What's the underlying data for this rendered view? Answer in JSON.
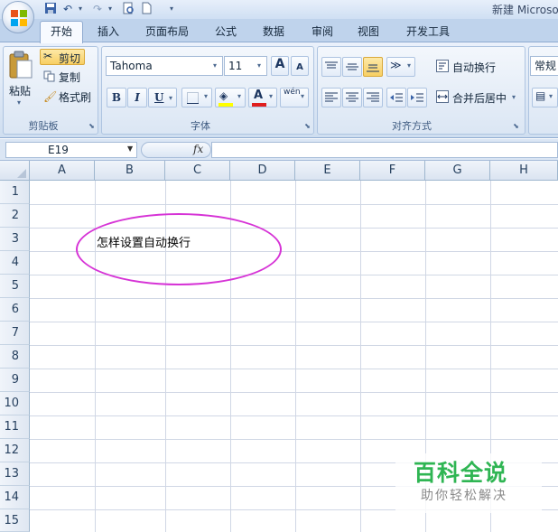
{
  "window": {
    "title": "新建 Microso"
  },
  "tabs": [
    "开始",
    "插入",
    "页面布局",
    "公式",
    "数据",
    "审阅",
    "视图",
    "开发工具"
  ],
  "clipboard": {
    "paste_label": "粘贴",
    "cut_label": "剪切",
    "copy_label": "复制",
    "format_painter_label": "格式刷",
    "group_label": "剪贴板"
  },
  "font": {
    "name": "Tahoma",
    "size": "11",
    "group_label": "字体",
    "grow_label": "A",
    "shrink_label": "A",
    "bold_label": "B",
    "italic_label": "I",
    "underline_label": "U",
    "font_color_label": "A",
    "phonetic_label": "wén"
  },
  "alignment": {
    "wrap_text_label": "自动换行",
    "merge_center_label": "合并后居中",
    "group_label": "对齐方式"
  },
  "number": {
    "format_value": "常规"
  },
  "formula_bar": {
    "name_box": "E19",
    "fx_label": "fx",
    "formula": ""
  },
  "sheet": {
    "columns": [
      "A",
      "B",
      "C",
      "D",
      "E",
      "F",
      "G",
      "H"
    ],
    "rows": [
      "1",
      "2",
      "3",
      "4",
      "5",
      "6",
      "7",
      "8",
      "9",
      "10",
      "11",
      "12",
      "13",
      "14",
      "15"
    ],
    "cell_b3": "怎样设置自动换行",
    "annotation_color": "#d633d6"
  },
  "watermark": {
    "title": "百科全说",
    "subtitle": "助你轻松解决",
    "color": "#2fb553"
  }
}
